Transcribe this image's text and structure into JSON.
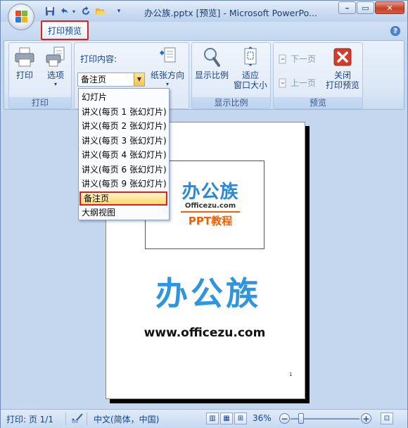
{
  "window": {
    "title": "办公族.pptx [预览] - Microsoft PowerPo..."
  },
  "ribbon": {
    "active_tab": "打印预览",
    "print_label": "打印",
    "options_label": "选项",
    "print_group_label": "打印",
    "print_content_label": "打印内容:",
    "print_content_value": "备注页",
    "orientation_label": "纸张方向",
    "zoom_label": "显示比例",
    "fit_label_1": "适应",
    "fit_label_2": "窗口大小",
    "zoom_group_label": "显示比例",
    "next_page": "下一页",
    "prev_page": "上一页",
    "close_label_1": "关闭",
    "close_label_2": "打印预览",
    "preview_group_label": "预览"
  },
  "dropdown": {
    "items": [
      "幻灯片",
      "讲义(每页 1 张幻灯片)",
      "讲义(每页 2 张幻灯片)",
      "讲义(每页 3 张幻灯片)",
      "讲义(每页 4 张幻灯片)",
      "讲义(每页 6 张幻灯片)",
      "讲义(每页 9 张幻灯片)",
      "备注页",
      "大纲视图"
    ],
    "selected": "备注页"
  },
  "page": {
    "slide_logo_cn": "办公族",
    "slide_logo_url": "Officezu.com",
    "slide_logo_sub": "PPT教程",
    "big_logo_cn": "办公族",
    "big_logo_url": "www.officezu.com",
    "page_number": "1"
  },
  "statusbar": {
    "page_info": "打印: 页 1/1",
    "language": "中文(简体，中国)",
    "zoom": "36%"
  },
  "colors": {
    "accent": "#15428b",
    "highlight_border": "#e02020",
    "logo_blue": "#2e96e0",
    "logo_orange": "#f06000"
  },
  "icons": {
    "office_button": "office-logo-icon",
    "save": "save-icon",
    "undo": "undo-icon",
    "redo": "redo-icon",
    "open": "folder-open-icon",
    "help": "help-icon"
  }
}
